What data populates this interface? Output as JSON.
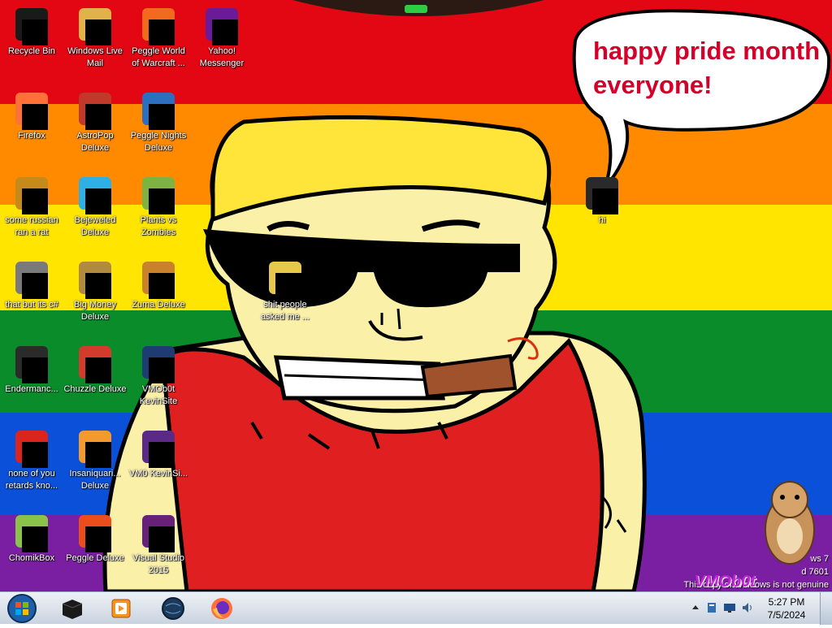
{
  "desktop": {
    "bubble_text": "happy pride month everyone!",
    "icons": [
      {
        "label": "Recycle Bin",
        "icon": "recycle-bin-icon",
        "color": "#1a1a1a"
      },
      {
        "label": "Windows Live Mail",
        "icon": "mail-icon",
        "color": "#e0b24a"
      },
      {
        "label": "Peggle World of Warcraft ...",
        "icon": "peggle-icon",
        "color": "#f26b1d"
      },
      {
        "label": "Yahoo! Messenger",
        "icon": "yahoo-icon",
        "color": "#6a1b9a"
      },
      {
        "label": "Firefox",
        "icon": "firefox-icon",
        "color": "#ff7139"
      },
      {
        "label": "AstroPop Deluxe",
        "icon": "astropop-icon",
        "color": "#c0392b"
      },
      {
        "label": "Peggle Nights Deluxe",
        "icon": "peggle-nights-icon",
        "color": "#2c6fbf"
      },
      {
        "label": "some russian ran a rat",
        "icon": "rat-program-icon",
        "color": "#c58a1c"
      },
      {
        "label": "Bejeweled Deluxe",
        "icon": "bejeweled-icon",
        "color": "#2eb0e6"
      },
      {
        "label": "Plants vs Zombies",
        "icon": "pvz-icon",
        "color": "#7cb342"
      },
      {
        "label": "that but its c#",
        "icon": "stacked-windows-icon",
        "color": "#7a7a7a"
      },
      {
        "label": "Big Money Deluxe",
        "icon": "money-bag-icon",
        "color": "#b08a3e"
      },
      {
        "label": "Zuma Deluxe",
        "icon": "zuma-icon",
        "color": "#c9822a"
      },
      {
        "label": "Endermanc...",
        "icon": "terminal-icon",
        "color": "#2b2b2b"
      },
      {
        "label": "Chuzzle Deluxe",
        "icon": "chuzzle-icon",
        "color": "#d33b2c"
      },
      {
        "label": "VMOb0t KevinSite",
        "icon": "vmbot-icon",
        "color": "#1e3c72"
      },
      {
        "label": "none of you retards kno...",
        "icon": "opera-icon",
        "color": "#d9251d"
      },
      {
        "label": "Insaniquari... Deluxe",
        "icon": "insaniquarium-icon",
        "color": "#f29a2e"
      },
      {
        "label": "VM0 KevinSi...",
        "icon": "vm0-icon",
        "color": "#5b2a86"
      },
      {
        "label": "ChomikBox",
        "icon": "chomikbox-icon",
        "color": "#8bc34a"
      },
      {
        "label": "Peggle Deluxe",
        "icon": "peggle-deluxe-icon",
        "color": "#e94e1b"
      },
      {
        "label": "Visual Studio 2015",
        "icon": "visual-studio-icon",
        "color": "#68217a"
      },
      {
        "label": "hi",
        "icon": "folder-dark-icon",
        "color": "#2a2a2a"
      },
      {
        "label": "shit people asked me ...",
        "icon": "folder-icon",
        "color": "#e8c84a"
      }
    ]
  },
  "watermark": {
    "line1": "ws 7",
    "line2": "d 7601",
    "line3": "This copy of Windows is not genuine",
    "logo_text": "VMOb0t"
  },
  "taskbar": {
    "start_icon": "windows-orb-icon",
    "items": [
      {
        "icon": "black-box-app-icon"
      },
      {
        "icon": "media-player-icon"
      },
      {
        "icon": "globe-icon"
      },
      {
        "icon": "firefox-icon"
      }
    ],
    "tray_icons": [
      "show-hidden-icons-icon",
      "action-center-icon",
      "network-icon",
      "volume-icon"
    ],
    "clock_time": "5:27 PM",
    "clock_date": "7/5/2024"
  },
  "colors": {
    "stripes": [
      "#e30613",
      "#ff8a00",
      "#ffe500",
      "#0a8c2b",
      "#0b50d8",
      "#7b1fa2"
    ],
    "bubble_text": "#d4002a"
  }
}
